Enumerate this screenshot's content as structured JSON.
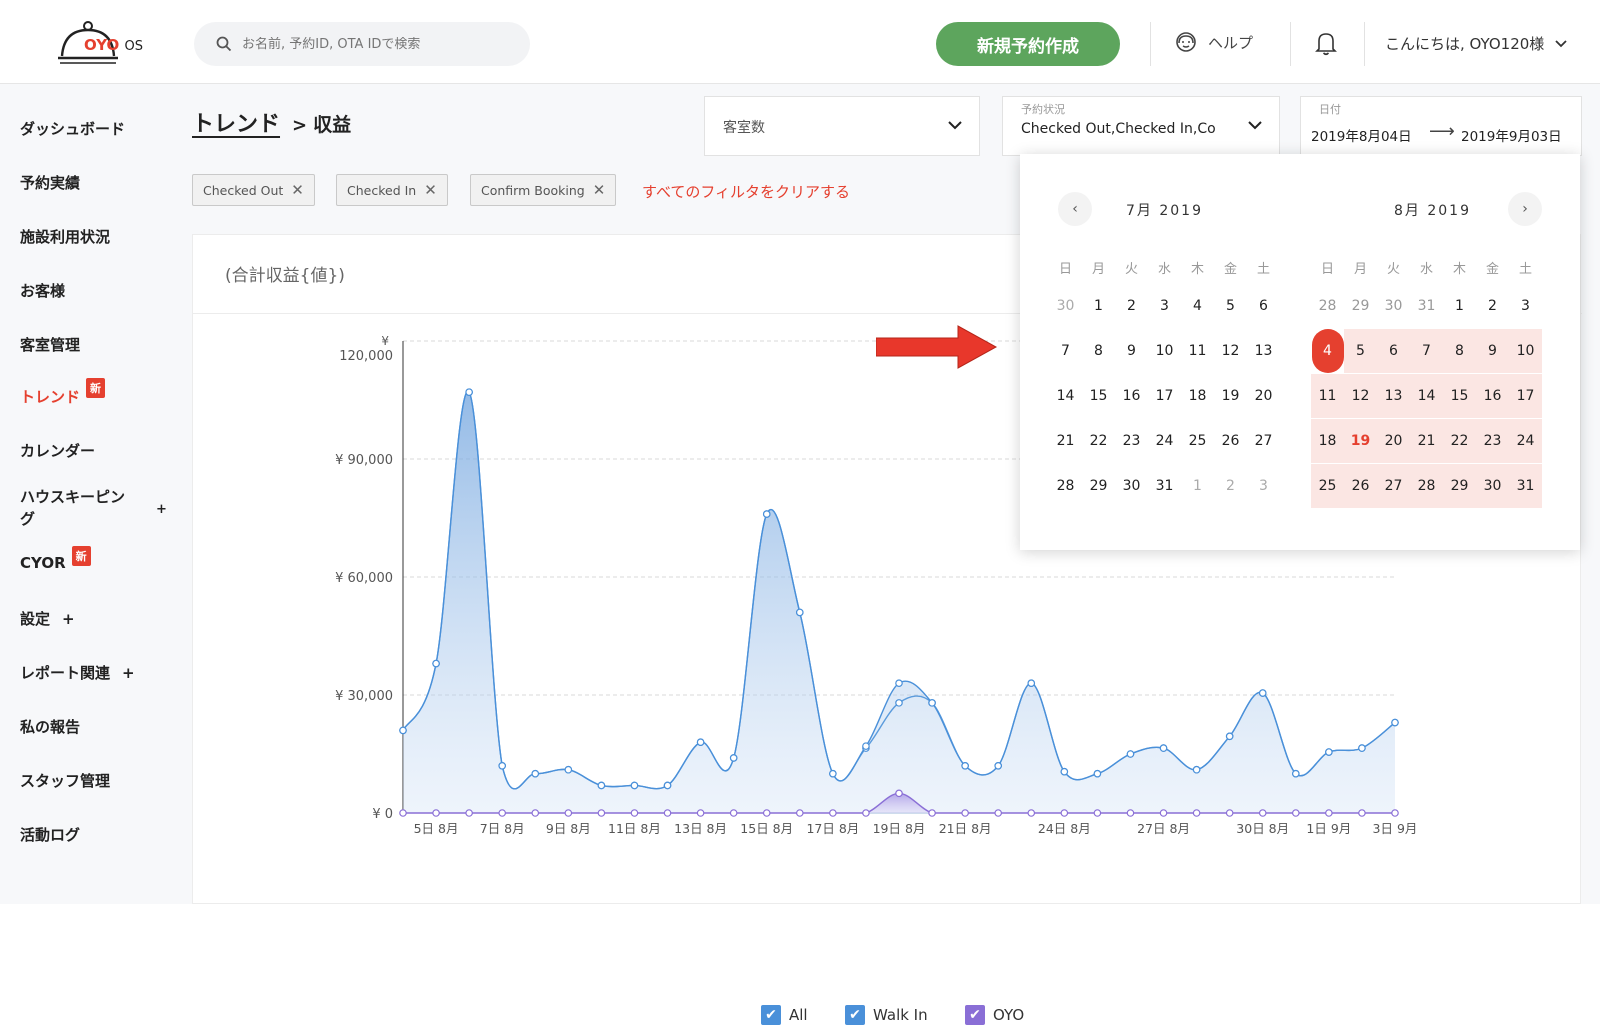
{
  "header": {
    "logo_name": "OYO",
    "logo_suffix": "OS",
    "search_placeholder": "お名前, 予約ID, OTA IDで検索",
    "new_booking_label": "新規予約作成",
    "help_label": "ヘルプ",
    "greeting": "こんにちは, OYO120様"
  },
  "sidebar": {
    "items": [
      {
        "label": "ダッシュボード"
      },
      {
        "label": "予約実績"
      },
      {
        "label": "施設利用状況"
      },
      {
        "label": "お客様"
      },
      {
        "label": "客室管理"
      },
      {
        "label": "トレンド",
        "badge": "新"
      },
      {
        "label": "カレンダー"
      },
      {
        "label": "ハウスキーピング",
        "line1": "ハウスキーピン",
        "line2": "グ",
        "plus": "+"
      },
      {
        "label": "CYOR",
        "badge": "新"
      },
      {
        "label": "設定",
        "plus": "+"
      },
      {
        "label": "レポート関連",
        "plus": "+"
      },
      {
        "label": "私の報告"
      },
      {
        "label": "スタッフ管理"
      },
      {
        "label": "活動ログ"
      }
    ]
  },
  "main": {
    "breadcrumb_link": "トレンド",
    "breadcrumb_sep": ">",
    "breadcrumb_current": "収益",
    "room_dropdown": {
      "value": "客室数"
    },
    "status_dropdown": {
      "label": "予約状況",
      "value": "Checked Out,Checked In,Co"
    },
    "date_dropdown": {
      "label": "日付",
      "from": "2019年8月04日",
      "arrow": "⟶",
      "to": "2019年9月03日"
    },
    "tags": [
      "Checked Out",
      "Checked In",
      "Confirm Booking"
    ],
    "clear_filters": "すべてのフィルタをクリアする",
    "card_title": "(合計収益{値})"
  },
  "calendar": {
    "weekdays": [
      "日",
      "月",
      "火",
      "水",
      "木",
      "金",
      "土"
    ],
    "prev_icon": "chevron-left-icon",
    "next_icon": "chevron-right-icon",
    "left": {
      "title": "7月 2019",
      "weeks": [
        [
          "30",
          "1",
          "2",
          "3",
          "4",
          "5",
          "6"
        ],
        [
          "7",
          "8",
          "9",
          "10",
          "11",
          "12",
          "13"
        ],
        [
          "14",
          "15",
          "16",
          "17",
          "18",
          "19",
          "20"
        ],
        [
          "21",
          "22",
          "23",
          "24",
          "25",
          "26",
          "27"
        ],
        [
          "28",
          "29",
          "30",
          "31",
          "1",
          "2",
          "3"
        ]
      ]
    },
    "right": {
      "title": "8月 2019",
      "weeks": [
        [
          "28",
          "29",
          "30",
          "31",
          "1",
          "2",
          "3"
        ],
        [
          "4",
          "5",
          "6",
          "7",
          "8",
          "9",
          "10"
        ],
        [
          "11",
          "12",
          "13",
          "14",
          "15",
          "16",
          "17"
        ],
        [
          "18",
          "19",
          "20",
          "21",
          "22",
          "23",
          "24"
        ],
        [
          "25",
          "26",
          "27",
          "28",
          "29",
          "30",
          "31"
        ]
      ],
      "selected_start": "4",
      "today": "19"
    }
  },
  "chart_data": {
    "type": "area",
    "title": "(合計収益{値})",
    "y_unit": "¥",
    "ylim": [
      0,
      120000
    ],
    "yticks": [
      "¥ 0",
      "¥ 30,000",
      "¥ 60,000",
      "¥ 90,000",
      "120,000"
    ],
    "x": [
      "4日 8月",
      "5日 8月",
      "6日 8月",
      "7日 8月",
      "8日 8月",
      "9日 8月",
      "10日 8月",
      "11日 8月",
      "12日 8月",
      "13日 8月",
      "14日 8月",
      "15日 8月",
      "16日 8月",
      "17日 8月",
      "18日 8月",
      "19日 8月",
      "20日 8月",
      "21日 8月",
      "22日 8月",
      "23日 8月",
      "24日 8月",
      "25日 8月",
      "26日 8月",
      "27日 8月",
      "28日 8月",
      "29日 8月",
      "30日 8月",
      "31日 8月",
      "1日 9月",
      "2日 9月",
      "3日 9月"
    ],
    "xtick_labels": [
      "5日 8月",
      "7日 8月",
      "9日 8月",
      "11日 8月",
      "13日 8月",
      "15日 8月",
      "17日 8月",
      "19日 8月",
      "21日 8月",
      "24日 8月",
      "27日 8月",
      "30日 8月",
      "1日 9月",
      "3日 9月"
    ],
    "series": [
      {
        "name": "All",
        "color": "#4a90d9",
        "values": [
          21000,
          38000,
          107000,
          12000,
          10000,
          11000,
          7000,
          7000,
          7000,
          18000,
          14000,
          76000,
          51000,
          10000,
          17000,
          33000,
          28000,
          12000,
          12000,
          33000,
          10500,
          10000,
          15000,
          16500,
          11000,
          19500,
          30500,
          10000,
          15500,
          16500,
          23000
        ]
      },
      {
        "name": "Walk In",
        "color": "#4a90d9",
        "values": [
          21000,
          38000,
          107000,
          12000,
          10000,
          11000,
          7000,
          7000,
          7000,
          18000,
          14000,
          76000,
          51000,
          10000,
          16500,
          28000,
          28000,
          12000,
          12000,
          33000,
          10500,
          10000,
          15000,
          16500,
          11000,
          19500,
          30500,
          10000,
          15500,
          16500,
          23000
        ]
      },
      {
        "name": "OYO",
        "color": "#8a6fd6",
        "values": [
          0,
          0,
          0,
          0,
          0,
          0,
          0,
          0,
          0,
          0,
          0,
          0,
          0,
          0,
          0,
          5000,
          0,
          0,
          0,
          0,
          0,
          0,
          0,
          0,
          0,
          0,
          0,
          0,
          0,
          0,
          0
        ]
      }
    ],
    "legend": [
      "All",
      "Walk In",
      "OYO"
    ],
    "legend_position": "bottom",
    "grid": true
  }
}
